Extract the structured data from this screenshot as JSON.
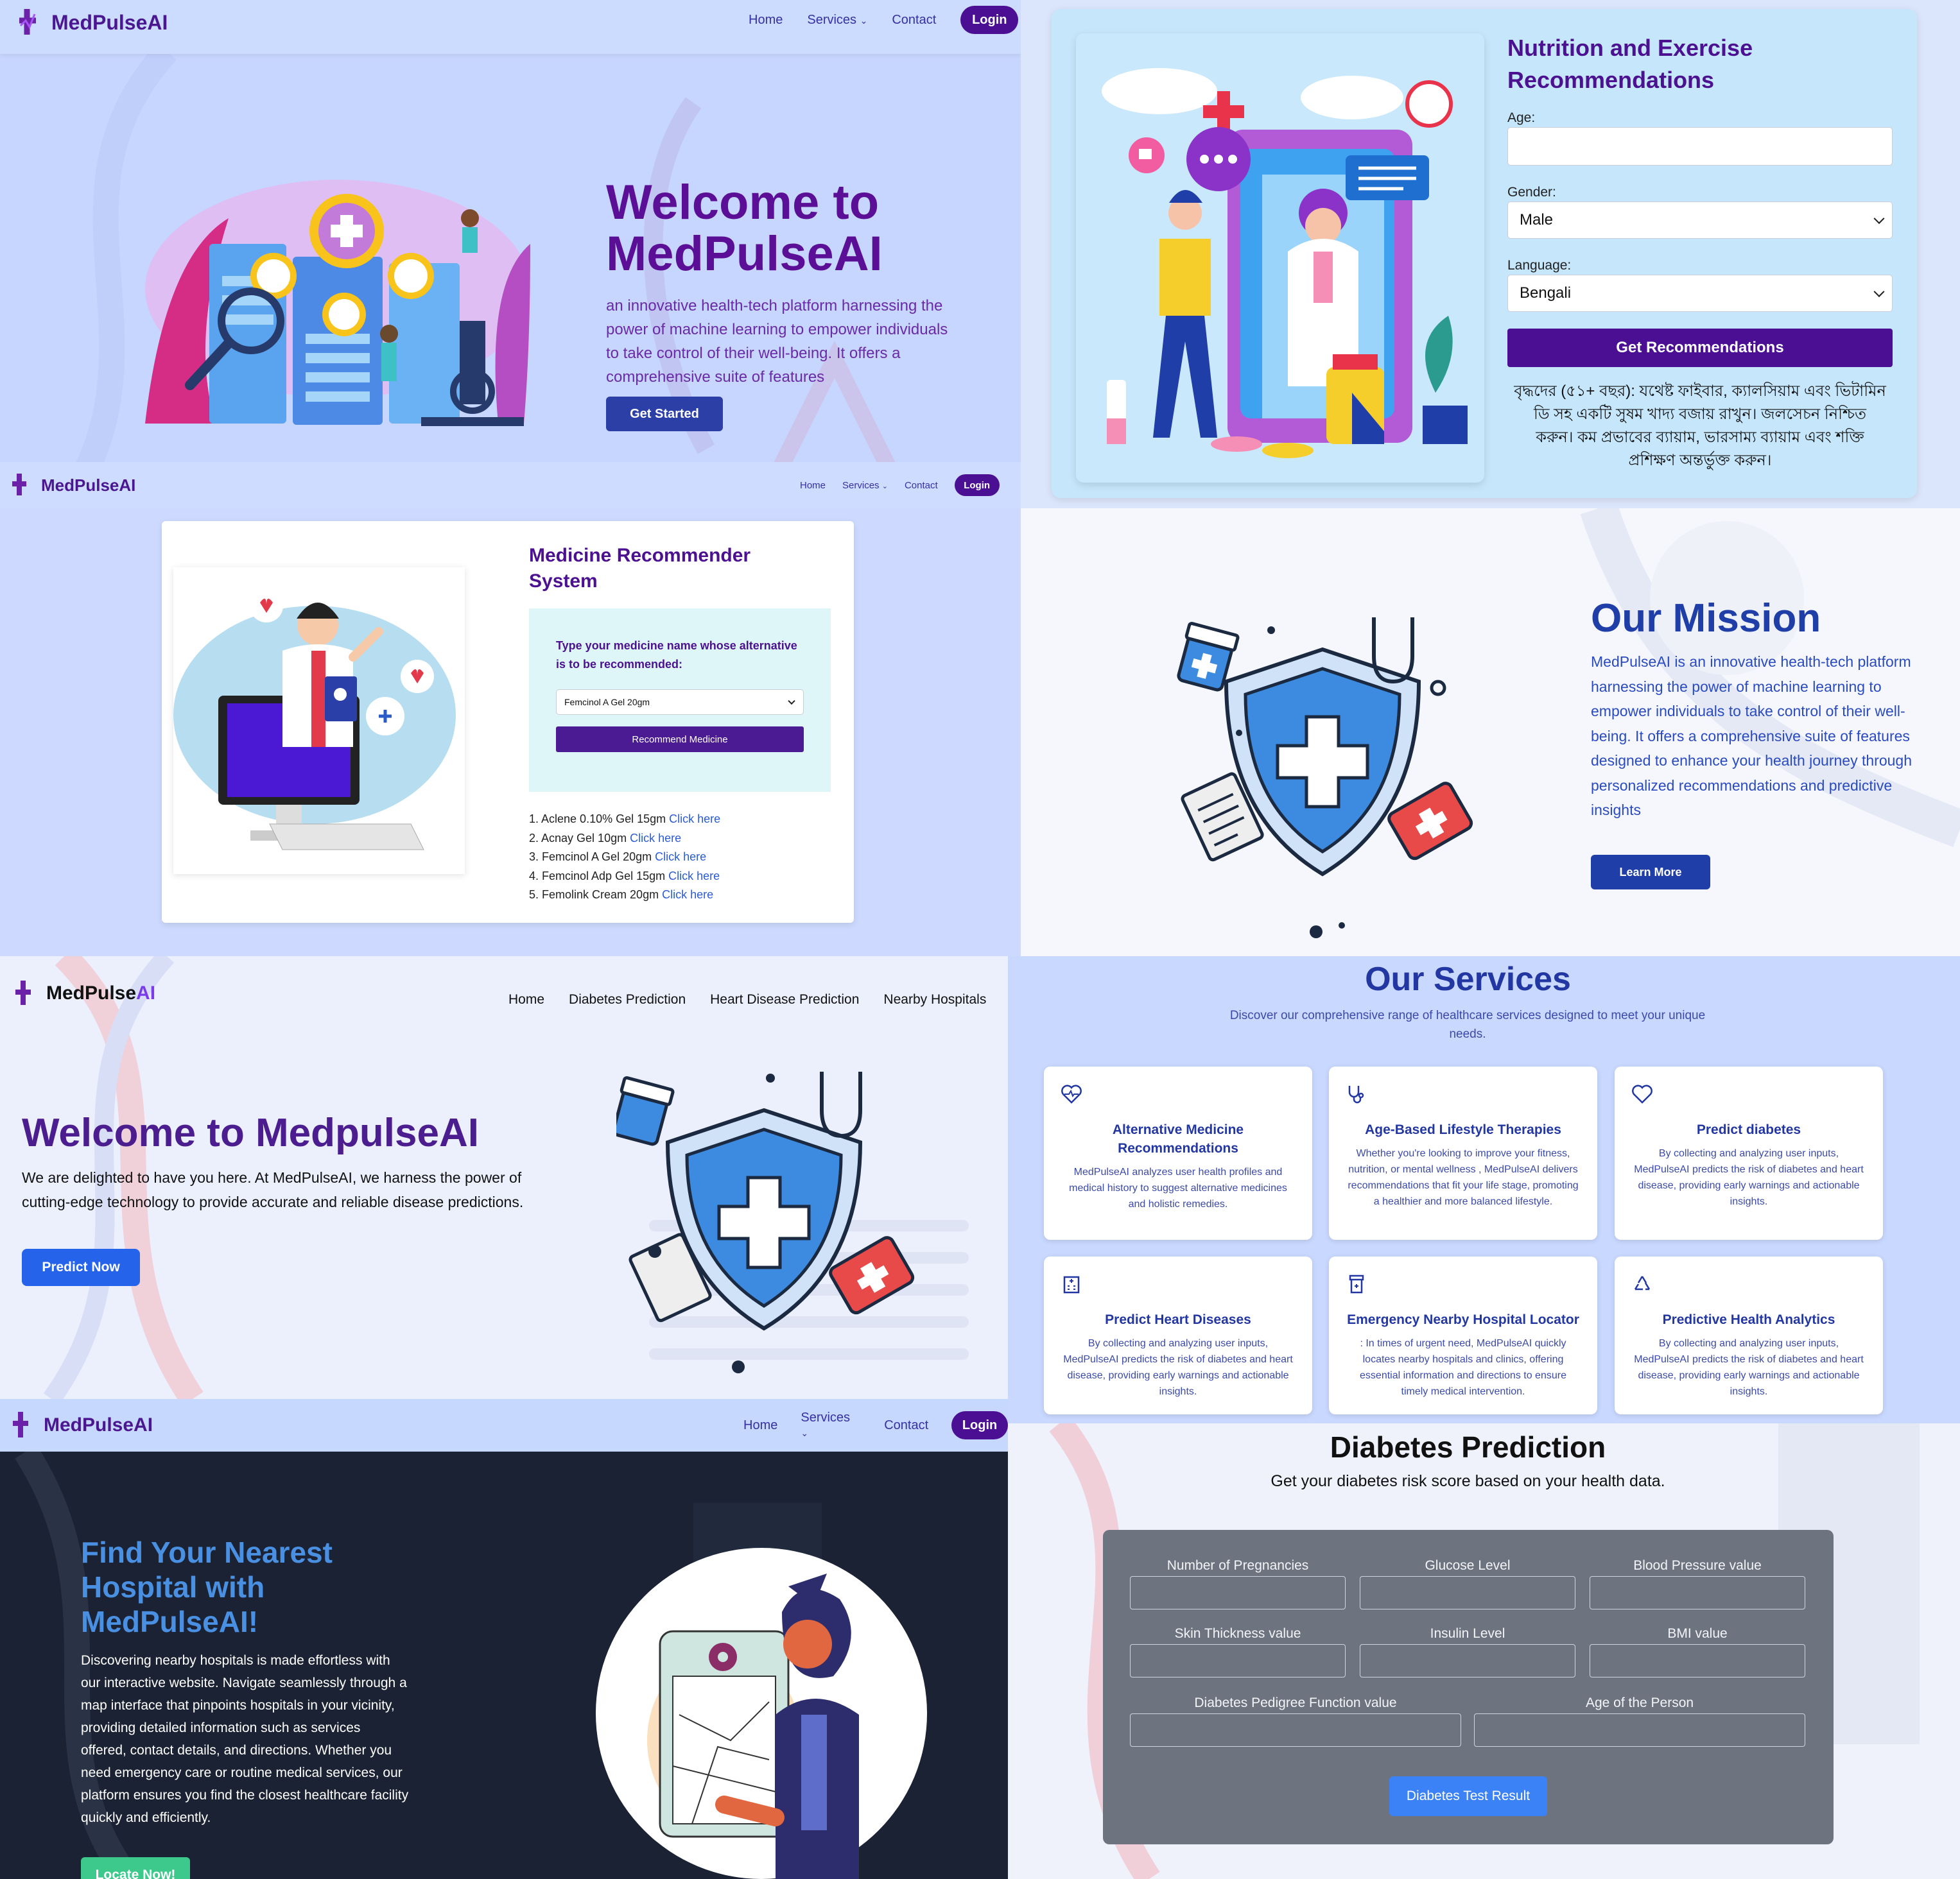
{
  "brand": "MedPulseAI",
  "nav": {
    "home": "Home",
    "services": "Services",
    "contact": "Contact",
    "login": "Login"
  },
  "nav_alt": [
    "Home",
    "Diabetes Prediction",
    "Heart Disease Prediction",
    "Nearby Hospitals"
  ],
  "welcome": {
    "title": "Welcome to MedPulseAI",
    "text": "an innovative health-tech platform harnessing the power of machine learning to empower individuals to take control of their well-being. It offers a comprehensive suite of features",
    "button": "Get Started"
  },
  "nutrition": {
    "title": "Nutrition and Exercise Recommendations",
    "age_label": "Age:",
    "age_value": "",
    "gender_label": "Gender:",
    "gender_value": "Male",
    "language_label": "Language:",
    "language_value": "Bengali",
    "button": "Get Recommendations",
    "result": "বৃদ্ধদের (৫১+ বছর): যথেষ্ট ফাইবার, ক্যালসিয়াম এবং ভিটামিন ডি সহ একটি সুষম খাদ্য বজায় রাখুন। জলসেচন নিশ্চিত করুন। কম প্রভাবের ব্যায়াম, ভারসাম্য ব্যায়াম এবং শক্তি প্রশিক্ষণ অন্তর্ভুক্ত করুন।"
  },
  "medicine": {
    "title": "Medicine Recommender System",
    "prompt": "Type your medicine name whose alternative is to be recommended:",
    "selected": "Femcinol A Gel 20gm",
    "button": "Recommend Medicine",
    "link_text": "Click here",
    "results": [
      "1. Aclene 0.10% Gel 15gm",
      "2. Acnay Gel 10gm",
      "3. Femcinol A Gel 20gm",
      "4. Femcinol Adp Gel 15gm",
      "5. Femolink Cream 20gm"
    ]
  },
  "mission": {
    "title": "Our Mission",
    "text": "MedPulseAI is an innovative health-tech platform harnessing the power of machine learning to empower individuals to take control of their well-being. It offers a comprehensive suite of features designed to enhance your health journey through personalized recommendations and predictive insights",
    "button": "Learn More"
  },
  "predict": {
    "brand_a": "MedPulse",
    "brand_b": "AI",
    "title": "Welcome to MedpulseAI",
    "text": "We are delighted to have you here. At MedPulseAI, we harness the power of cutting-edge technology to provide accurate and reliable disease predictions.",
    "button": "Predict Now"
  },
  "services": {
    "title": "Our Services",
    "subtitle": "Discover our comprehensive range of healthcare services designed to meet your unique needs.",
    "cards": [
      {
        "icon": "heart-pulse-icon",
        "title": "Alternative Medicine Recommendations",
        "text": "MedPulseAI analyzes user health profiles and medical history to suggest alternative medicines and holistic remedies."
      },
      {
        "icon": "stethoscope-icon",
        "title": "Age-Based Lifestyle Therapies",
        "text": "Whether you're looking to improve your fitness, nutrition, or mental wellness , MedPulseAI delivers recommendations that fit your life stage, promoting a healthier and more balanced lifestyle."
      },
      {
        "icon": "heart-icon",
        "title": "Predict diabetes",
        "text": "By collecting and analyzing user inputs, MedPulseAI predicts the risk of diabetes and heart disease, providing early warnings and actionable insights."
      },
      {
        "icon": "hospital-building-icon",
        "title": "Predict Heart Diseases",
        "text": "By collecting and analyzing user inputs, MedPulseAI predicts the risk of diabetes and heart disease, providing early warnings and actionable insights."
      },
      {
        "icon": "first-aid-kit-icon",
        "title": "Emergency Nearby Hospital Locator",
        "text": ": In times of urgent need, MedPulseAI quickly locates nearby hospitals and clinics, offering essential information and directions to ensure timely medical intervention."
      },
      {
        "icon": "recycle-icon",
        "title": "Predictive Health Analytics",
        "text": "By collecting and analyzing user inputs, MedPulseAI predicts the risk of diabetes and heart disease, providing early warnings and actionable insights."
      }
    ]
  },
  "hospital": {
    "title": "Find Your Nearest Hospital with MedPulseAI!",
    "text": "Discovering nearby hospitals is made effortless with our interactive website. Navigate seamlessly through a map interface that pinpoints hospitals in your vicinity, providing detailed information such as services offered, contact details, and directions. Whether you need emergency care or routine medical services, our platform ensures you find the closest healthcare facility quickly and efficiently.",
    "button": "Locate Now!"
  },
  "diabetes": {
    "title": "Diabetes Prediction",
    "subtitle": "Get your diabetes risk score based on your health data.",
    "fields": [
      "Number of Pregnancies",
      "Glucose Level",
      "Blood Pressure value",
      "Skin Thickness value",
      "Insulin Level",
      "BMI value",
      "Diabetes Pedigree Function value",
      "Age of the Person"
    ],
    "button": "Diabetes Test Result"
  },
  "colors": {
    "brand_purple": "#4b1190",
    "primary_blue": "#2b3fa6",
    "services_bg": "#c9d8ff",
    "dark_bg": "#1b2233"
  }
}
